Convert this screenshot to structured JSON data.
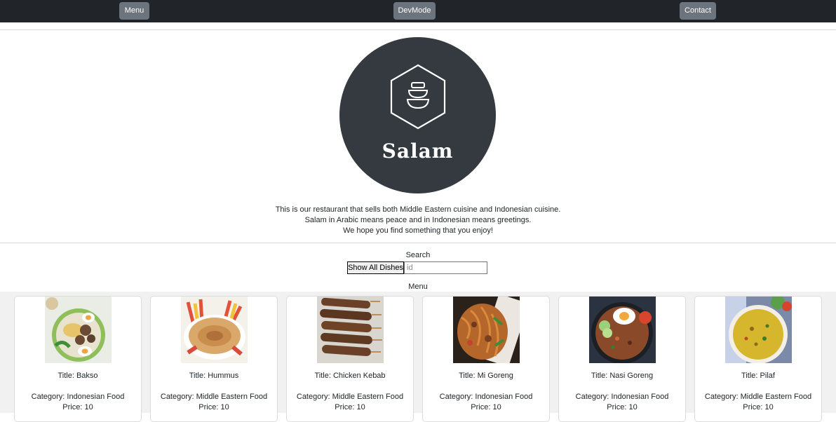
{
  "nav": {
    "menu_label": "Menu",
    "devmode_label": "DevMode",
    "contact_label": "Contact"
  },
  "logo": {
    "name": "Salam",
    "icon": "stacked-bowls-hexagon-icon"
  },
  "intro": {
    "line1": "This is our restaurant that sells both Middle Eastern cuisine and Indonesian cuisine.",
    "line2": "Salam in Arabic means peace and in Indonesian means greetings.",
    "line3": "We hope you find something that you enjoy!"
  },
  "search": {
    "label": "Search",
    "show_all_label": "Show All Dishes",
    "placeholder": "id",
    "value": ""
  },
  "menu": {
    "label": "Menu",
    "dishes": [
      {
        "title": "Title: Bakso",
        "category": "Category: Indonesian Food",
        "price": "Price: 10"
      },
      {
        "title": "Title: Hummus",
        "category": "Category: Middle Eastern Food",
        "price": "Price: 10"
      },
      {
        "title": "Title: Chicken Kebab",
        "category": "Category: Middle Eastern Food",
        "price": "Price: 10"
      },
      {
        "title": "Title: Mi Goreng",
        "category": "Category: Indonesian Food",
        "price": "Price: 10"
      },
      {
        "title": "Title: Nasi Goreng",
        "category": "Category: Indonesian Food",
        "price": "Price: 10"
      },
      {
        "title": "Title: Pilaf",
        "category": "Category: Middle Eastern Food",
        "price": "Price: 10"
      }
    ]
  },
  "colors": {
    "topbar": "#212529",
    "button": "#6c757d",
    "logo_bg": "#343a40",
    "grid_bg": "#f1f1f1"
  }
}
